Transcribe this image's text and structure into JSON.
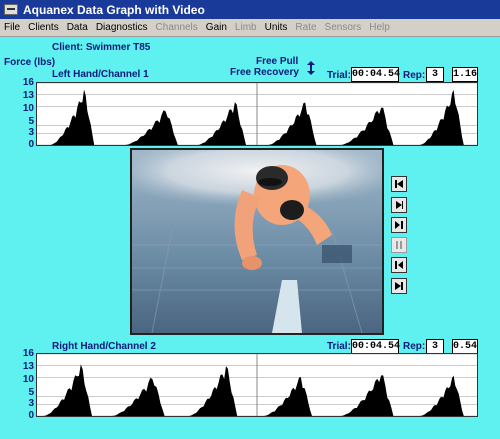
{
  "window": {
    "title": "Aquanex Data Graph with Video"
  },
  "menu": [
    {
      "label": "File",
      "enabled": true
    },
    {
      "label": "Clients",
      "enabled": true
    },
    {
      "label": "Data",
      "enabled": true
    },
    {
      "label": "Diagnostics",
      "enabled": true
    },
    {
      "label": "Channels",
      "enabled": false
    },
    {
      "label": "Gain",
      "enabled": true
    },
    {
      "label": "Limb",
      "enabled": false
    },
    {
      "label": "Units",
      "enabled": true
    },
    {
      "label": "Rate",
      "enabled": false
    },
    {
      "label": "Sensors",
      "enabled": false
    },
    {
      "label": "Help",
      "enabled": false
    }
  ],
  "client_label": "Client: Swimmer T85",
  "force_label": "Force (lbs)",
  "stroke": {
    "line1": "Free Pull",
    "line2": "Free Recovery"
  },
  "top_channel": {
    "title": "Left Hand/Channel 1",
    "trial_label": "Trial:",
    "trial_value": "00:04.54",
    "rep_label": "Rep:",
    "rep_value": "3",
    "value": "1.16"
  },
  "bottom_channel": {
    "title": "Right Hand/Channel 2",
    "trial_label": "Trial:",
    "trial_value": "00:04.54",
    "rep_label": "Rep:",
    "rep_value": "3",
    "value": "0.54"
  },
  "y_ticks": [
    "16",
    "13",
    "10",
    "5",
    "3",
    "0"
  ],
  "chart_data": [
    {
      "type": "area",
      "name": "Left Hand/Channel 1",
      "ylabel": "Force (lbs)",
      "ylim": [
        0,
        16
      ],
      "y_ticks": [
        0,
        3,
        5,
        10,
        13,
        16
      ],
      "grid": true,
      "peaks": [
        {
          "center": 0.08,
          "width": 0.1,
          "peak": 15
        },
        {
          "center": 0.26,
          "width": 0.12,
          "peak": 10
        },
        {
          "center": 0.42,
          "width": 0.11,
          "peak": 12
        },
        {
          "center": 0.58,
          "width": 0.11,
          "peak": 12
        },
        {
          "center": 0.75,
          "width": 0.12,
          "peak": 11
        },
        {
          "center": 0.92,
          "width": 0.1,
          "peak": 15
        }
      ],
      "cursor_x": 0.5
    },
    {
      "type": "area",
      "name": "Right Hand/Channel 2",
      "ylabel": "Force (lbs)",
      "ylim": [
        0,
        16
      ],
      "y_ticks": [
        0,
        3,
        5,
        10,
        13,
        16
      ],
      "grid": true,
      "peaks": [
        {
          "center": 0.07,
          "width": 0.11,
          "peak": 14
        },
        {
          "center": 0.23,
          "width": 0.12,
          "peak": 11
        },
        {
          "center": 0.4,
          "width": 0.11,
          "peak": 14
        },
        {
          "center": 0.57,
          "width": 0.11,
          "peak": 11
        },
        {
          "center": 0.75,
          "width": 0.12,
          "peak": 12
        },
        {
          "center": 0.92,
          "width": 0.1,
          "peak": 11
        }
      ],
      "cursor_x": 0.5
    }
  ],
  "video_controls": [
    {
      "name": "go-to-start",
      "enabled": true
    },
    {
      "name": "play",
      "enabled": true
    },
    {
      "name": "step-forward",
      "enabled": true
    },
    {
      "name": "pause",
      "enabled": false
    },
    {
      "name": "step-back",
      "enabled": true
    },
    {
      "name": "go-to-end",
      "enabled": true
    }
  ]
}
